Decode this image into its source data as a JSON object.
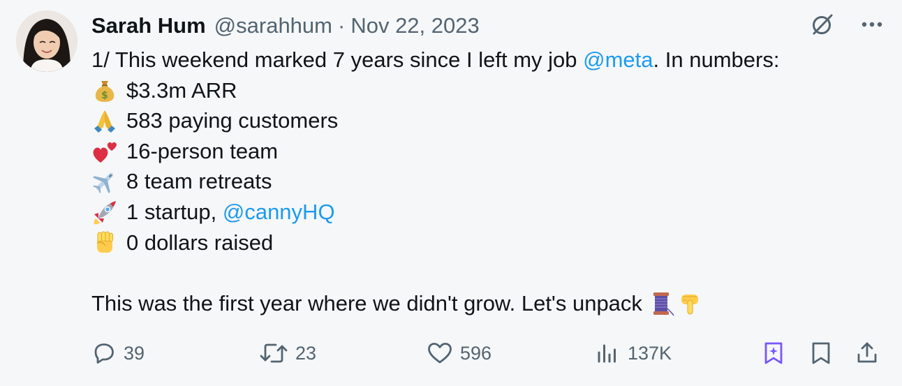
{
  "author": {
    "name": "Sarah Hum",
    "handle": "@sarahhum",
    "separator": "·",
    "date": "Nov 22, 2023"
  },
  "tweet": {
    "intro_text": "1/ This weekend marked 7 years since I left my job ",
    "intro_mention": "@meta",
    "intro_suffix": ". In numbers:",
    "stats": [
      {
        "icon": "money-bag-icon",
        "text": "$3.3m ARR"
      },
      {
        "icon": "folded-hands-icon",
        "text": "583 paying customers"
      },
      {
        "icon": "two-hearts-icon",
        "text": "16-person team"
      },
      {
        "icon": "airplane-icon",
        "text": "8 team retreats"
      },
      {
        "icon": "rocket-icon",
        "text": "1 startup, ",
        "mention": "@cannyHQ"
      },
      {
        "icon": "raised-fist-icon",
        "text": "0 dollars raised"
      }
    ],
    "closing_text": "This was the first year where we didn't grow. Let's unpack",
    "closing_icons": [
      "thread-icon",
      "pointing-down-icon"
    ]
  },
  "actions": {
    "replies": "39",
    "reposts": "23",
    "likes": "596",
    "views": "137K"
  },
  "colors": {
    "text": "#0f1419",
    "secondary": "#536471",
    "link": "#1d9bf0",
    "grok_purple": "#7856ff",
    "background": "#f6f7f8"
  }
}
